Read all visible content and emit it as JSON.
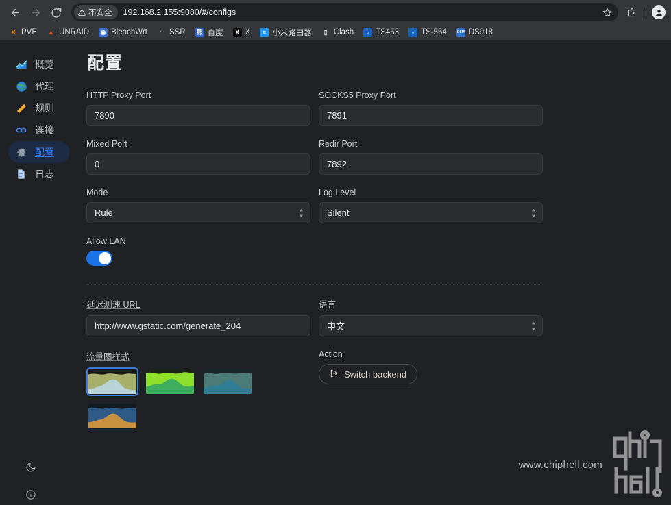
{
  "browser": {
    "back_label": "Back",
    "forward_label": "Forward",
    "reload_label": "Reload",
    "security_badge": "不安全",
    "url": "192.168.2.155:9080/#/configs",
    "bookmark_star": "star-icon",
    "extensions": "extensions-icon",
    "profile": "profile-avatar",
    "bookmarks": [
      {
        "label": "PVE",
        "glyph": "✕",
        "fg": "#ff8c00",
        "bg": "transparent"
      },
      {
        "label": "UNRAID",
        "glyph": "▲",
        "fg": "#f15a24",
        "bg": "transparent"
      },
      {
        "label": "BleachWrt",
        "glyph": "◉",
        "fg": "#ffffff",
        "bg": "#3a6fd8"
      },
      {
        "label": "SSR",
        "glyph": "ᵔ",
        "fg": "#8a8d91",
        "bg": "transparent"
      },
      {
        "label": "百度",
        "glyph": "熊",
        "fg": "#ffffff",
        "bg": "#2b5fd9"
      },
      {
        "label": "X",
        "glyph": "X",
        "fg": "#ffffff",
        "bg": "#0b0b0b"
      },
      {
        "label": "小米路由器",
        "glyph": "≈",
        "fg": "#ffffff",
        "bg": "#2196f3"
      },
      {
        "label": "Clash",
        "glyph": "▯",
        "fg": "#cfd8e3",
        "bg": "transparent"
      },
      {
        "label": "TS453",
        "glyph": "▫",
        "fg": "#ffffff",
        "bg": "#1565c0"
      },
      {
        "label": "TS-564",
        "glyph": "▫",
        "fg": "#ffffff",
        "bg": "#1565c0"
      },
      {
        "label": "DS918",
        "glyph": "DSM",
        "fg": "#ffffff",
        "bg": "#2a6fc9"
      }
    ]
  },
  "sidebar": {
    "items": [
      {
        "label": "概览",
        "icon": "overview-chart-icon"
      },
      {
        "label": "代理",
        "icon": "globe-icon"
      },
      {
        "label": "规则",
        "icon": "ruler-icon"
      },
      {
        "label": "连接",
        "icon": "link-icon"
      },
      {
        "label": "配置",
        "icon": "gear-icon"
      },
      {
        "label": "日志",
        "icon": "document-icon"
      }
    ],
    "active_index": 4,
    "bottom": [
      {
        "icon": "moon-icon",
        "name": "theme-toggle"
      },
      {
        "icon": "info-icon",
        "name": "about-button"
      }
    ]
  },
  "page": {
    "title": "配置"
  },
  "form": {
    "http_proxy_port": {
      "label": "HTTP Proxy Port",
      "value": "7890"
    },
    "socks5_proxy_port": {
      "label": "SOCKS5 Proxy Port",
      "value": "7891"
    },
    "mixed_port": {
      "label": "Mixed Port",
      "value": "0"
    },
    "redir_port": {
      "label": "Redir Port",
      "value": "7892"
    },
    "mode": {
      "label": "Mode",
      "value": "Rule"
    },
    "log_level": {
      "label": "Log Level",
      "value": "Silent"
    },
    "allow_lan": {
      "label": "Allow LAN",
      "value": "on"
    },
    "latency_test_url": {
      "label": "延迟测速 URL",
      "value": "http://www.gstatic.com/generate_204"
    },
    "language": {
      "label": "语言",
      "value": "中文"
    },
    "chart_style": {
      "label": "流量图样式"
    },
    "action": {
      "label": "Action",
      "button": "Switch backend",
      "icon": "switch-backend-icon"
    }
  },
  "chart_styles": [
    {
      "name": "style-olive-steel",
      "selected": true,
      "bg": "#1a1a18",
      "upper": "#a7b06a",
      "lower": "#b8d4d8"
    },
    {
      "name": "style-bright-green",
      "selected": false,
      "bg": "#1a2418",
      "upper": "#8fe02a",
      "lower": "#3fae5c"
    },
    {
      "name": "style-teal-slate",
      "selected": false,
      "bg": "#17242a",
      "upper": "#4c7a75",
      "lower": "#2f7e96"
    },
    {
      "name": "style-blue-amber",
      "selected": false,
      "bg": "#121a22",
      "upper": "#2e5a87",
      "lower": "#c8913f"
    }
  ],
  "watermark": {
    "text": "www.chiphell.com",
    "logo": "chiphell-logo"
  },
  "colors": {
    "accent": "#1a73e8",
    "active_pill_bg": "#1e2b45",
    "active_text": "#2f7df6",
    "app_bg": "#202124",
    "input_bg": "#2b2c2f",
    "chrome_bg": "#35363a"
  }
}
